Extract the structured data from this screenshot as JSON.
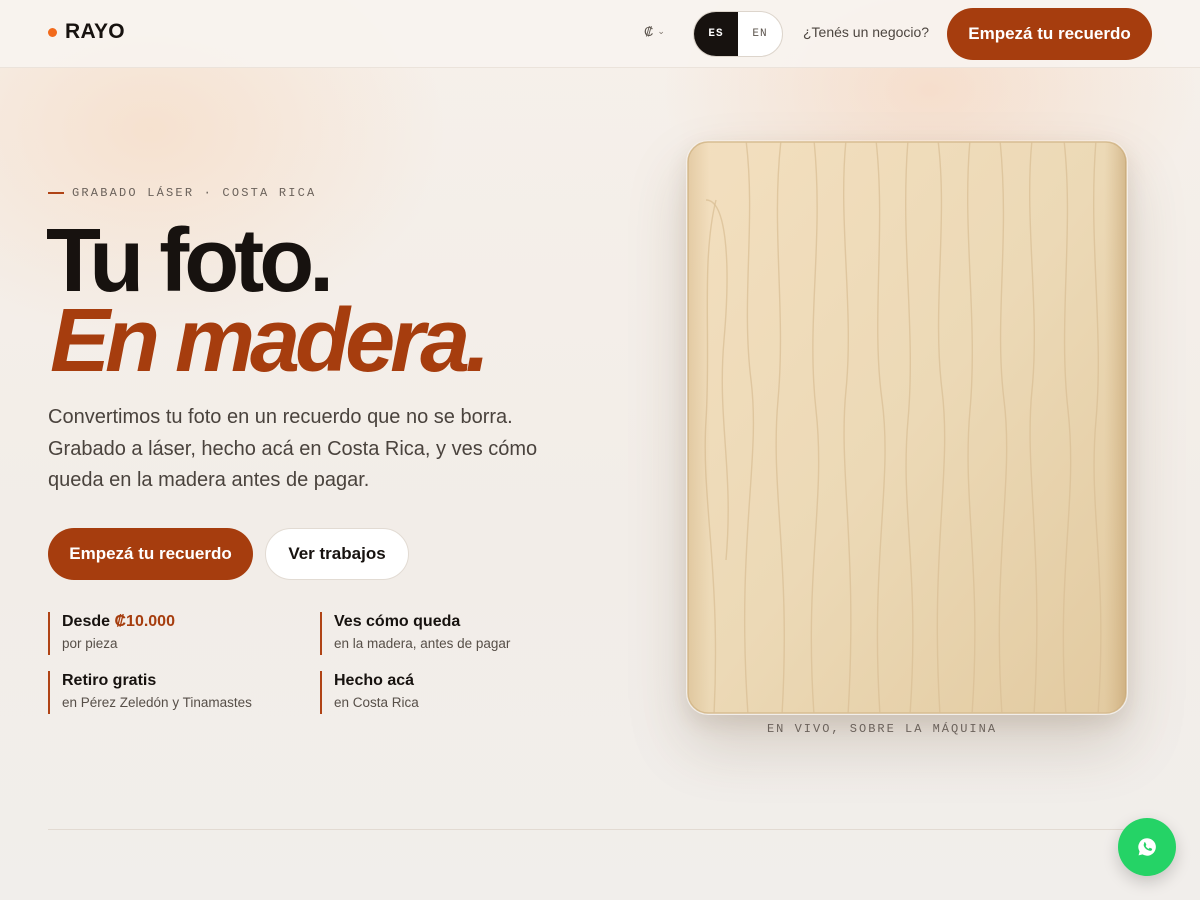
{
  "header": {
    "brand": "RAYO",
    "currency_symbol": "₡",
    "languages": [
      {
        "code": "ES",
        "active": true
      },
      {
        "code": "EN",
        "active": false
      }
    ],
    "business_link": "¿Tenés un negocio?",
    "cta_label": "Empezá tu recuerdo"
  },
  "hero": {
    "eyebrow": "GRABADO LÁSER · COSTA RICA",
    "title_line1": "Tu foto.",
    "title_line2": "En madera.",
    "lede": "Convertimos tu foto en un recuerdo que no se borra. Grabado a láser, hecho acá en Costa Rica, y ves cómo queda en la madera antes de pagar.",
    "primary_button": "Empezá tu recuerdo",
    "secondary_button": "Ver trabajos",
    "features": [
      {
        "title_prefix": "Desde",
        "title_accent": "₡10.000",
        "subtitle": "por pieza"
      },
      {
        "title": "Ves cómo queda",
        "subtitle": "en la madera, antes de pagar"
      },
      {
        "title": "Retiro gratis",
        "subtitle": "en Pérez Zeledón y Tinamastes"
      },
      {
        "title": "Hecho acá",
        "subtitle": "en Costa Rica"
      }
    ],
    "preview_caption": "EN VIVO, SOBRE LA MÁQUINA"
  },
  "colors": {
    "accent": "#a63d0e",
    "logo_dot": "#f26a1b",
    "whatsapp": "#25d366",
    "wood": "#ecd9b6"
  },
  "icons": {
    "logo_dot": "dot-icon",
    "currency_chevron": "chevron-down-icon",
    "whatsapp": "whatsapp-icon"
  }
}
